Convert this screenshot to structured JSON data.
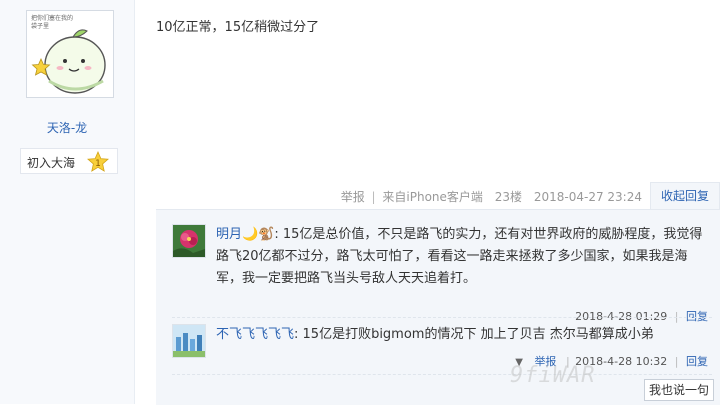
{
  "user": {
    "avatar_caption": "把你们塞在我的袋子里",
    "name": "天洛-龙",
    "level_name": "初入大海",
    "level_number": "1"
  },
  "post": {
    "content": "10亿正常，15亿稍微过分了",
    "report_label": "举报",
    "separator": "|",
    "source": "来自iPhone客户端",
    "floor": "23楼",
    "time": "2018-04-27 23:24"
  },
  "reply_tab": {
    "label": "收起回复"
  },
  "replies": [
    {
      "user": "明月🌙🐒",
      "text": ": 15亿是总价值，不只是路飞的实力，还有对世界政府的威胁程度，我觉得路飞20亿都不过分，路飞太可怕了，看看这一路走来拯救了多少国家，如果我是海军，我一定要把路飞当头号敌人天天追着打。",
      "time": "2018-4-28 01:29",
      "action": "回复"
    },
    {
      "user": "不飞飞飞飞飞",
      "text": ": 15亿是打败bigmom的情况下 加上了贝吉 杰尔马都算成小弟",
      "time": "2018-4-28 10:32",
      "action": "回复",
      "report": "举报"
    }
  ],
  "say_button": {
    "label": "我也说一句"
  },
  "watermark": {
    "text": "9fiWAR"
  },
  "colors": {
    "link": "#2d64b3",
    "reply_bg": "#f3f6fa",
    "sidebar_bg": "#f7f9fc"
  },
  "icons": {
    "level": "star-badge-icon",
    "chevron": "chevron-down-icon"
  }
}
